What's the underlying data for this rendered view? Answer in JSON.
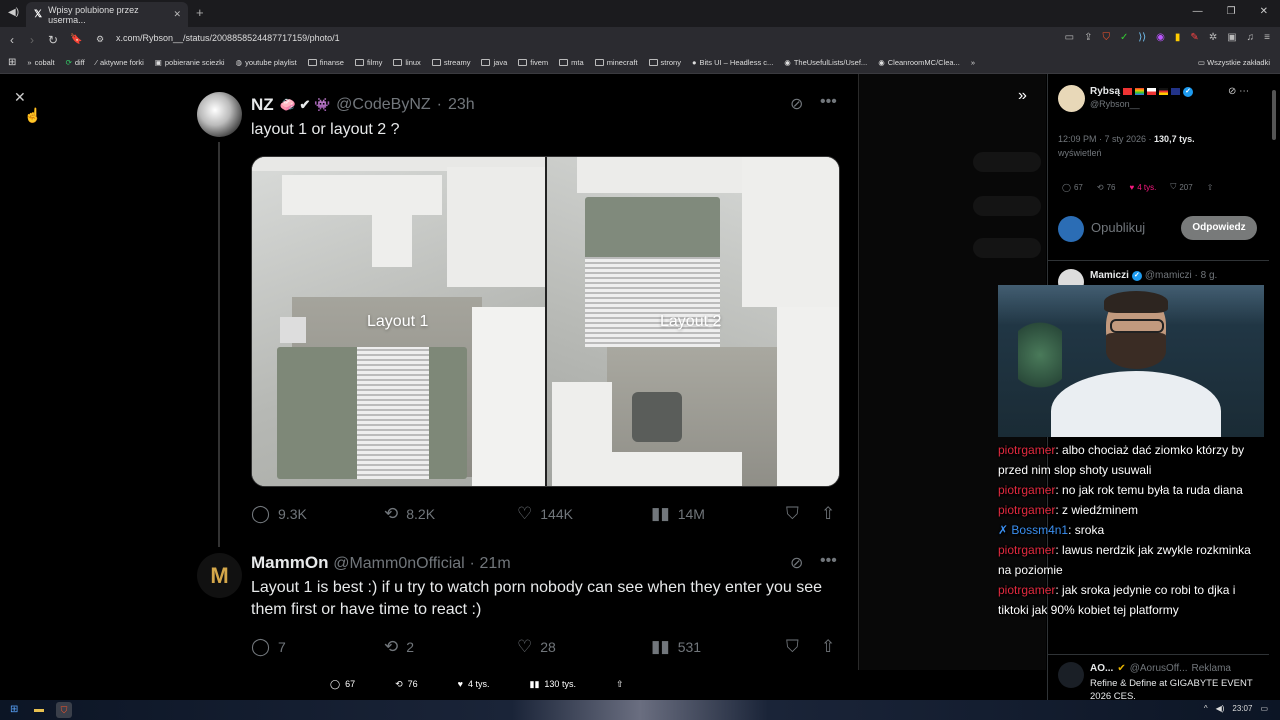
{
  "browser": {
    "tab_title": "Wpisy polubione przez userma...",
    "url": "x.com/Rybson__/status/2008858524487717159/photo/1",
    "bookmarks": [
      "cobalt",
      "diff",
      "aktywne forki",
      "pobieranie sciezki",
      "youtube playlist",
      "finanse",
      "filmy",
      "linux",
      "streamy",
      "java",
      "fivem",
      "mta",
      "minecraft",
      "strony",
      "Bits UI – Headless c...",
      "TheUsefulLists/Usef...",
      "CleanroomMC/Clea..."
    ],
    "bookmarks_all": "Wszystkie zakładki"
  },
  "tweet": {
    "author_name": "NZ",
    "emoji": "🧼 ✔ 👾",
    "handle": "@CodeByNZ",
    "time": "23h",
    "text": "layout 1 or layout 2 ?",
    "image_labels": [
      "Layout 1",
      "Layout 2"
    ],
    "stats": {
      "replies": "9.3K",
      "reposts": "8.2K",
      "likes": "144K",
      "views": "14M"
    }
  },
  "reply": {
    "author_name": "MammOn",
    "handle": "@Mamm0nOfficial",
    "time": "21m",
    "text": "Layout 1 is best :) if u try to watch porn nobody can see when they enter you see them first or have time to react :)",
    "stats": {
      "replies": "7",
      "reposts": "2",
      "likes": "28",
      "views": "531"
    }
  },
  "bottom_bar": {
    "replies": "67",
    "reposts": "76",
    "likes": "4 tys.",
    "views": "130 tys."
  },
  "right_panel": {
    "author_name": "Rybsą",
    "handle": "@Rybson__",
    "meta_time": "12:09 PM · 7 sty 2026 · ",
    "meta_views": "130,7 tys.",
    "meta_views_label": "wyświetleń",
    "stats": {
      "replies": "67",
      "reposts": "76",
      "likes": "4 tys.",
      "bookmarks": "207"
    },
    "reply_placeholder": "Opublikuj",
    "reply_button": "Odpowiedz",
    "next_reply_name": "Mamiczi",
    "next_reply_handle": "@mamiczi · 8 g."
  },
  "chat": [
    {
      "user": "piotrgamer",
      "text": "albo chociaż dać ziomko którzy by przed nim slop shoty usuwali"
    },
    {
      "user": "piotrgamer",
      "text": "no jak rok temu była ta ruda diana"
    },
    {
      "user": "piotrgamer",
      "text": "z wiedźminem"
    },
    {
      "user": "Bossm4n1",
      "text": "sroka"
    },
    {
      "user": "piotrgamer",
      "text": "lawus nerdzik jak zwykle rozkminka na poziomie"
    },
    {
      "user": "piotrgamer",
      "text": "jak sroka jedynie co robi to djka i tiktoki jak 90% kobiet tej platformy"
    }
  ],
  "ad": {
    "name": "AO...",
    "handle": "@AorusOff...",
    "label": "Reklama",
    "text": "Refine & Define at GIGABYTE EVENT 2026 CES."
  },
  "taskbar": {
    "time": "23:07"
  }
}
